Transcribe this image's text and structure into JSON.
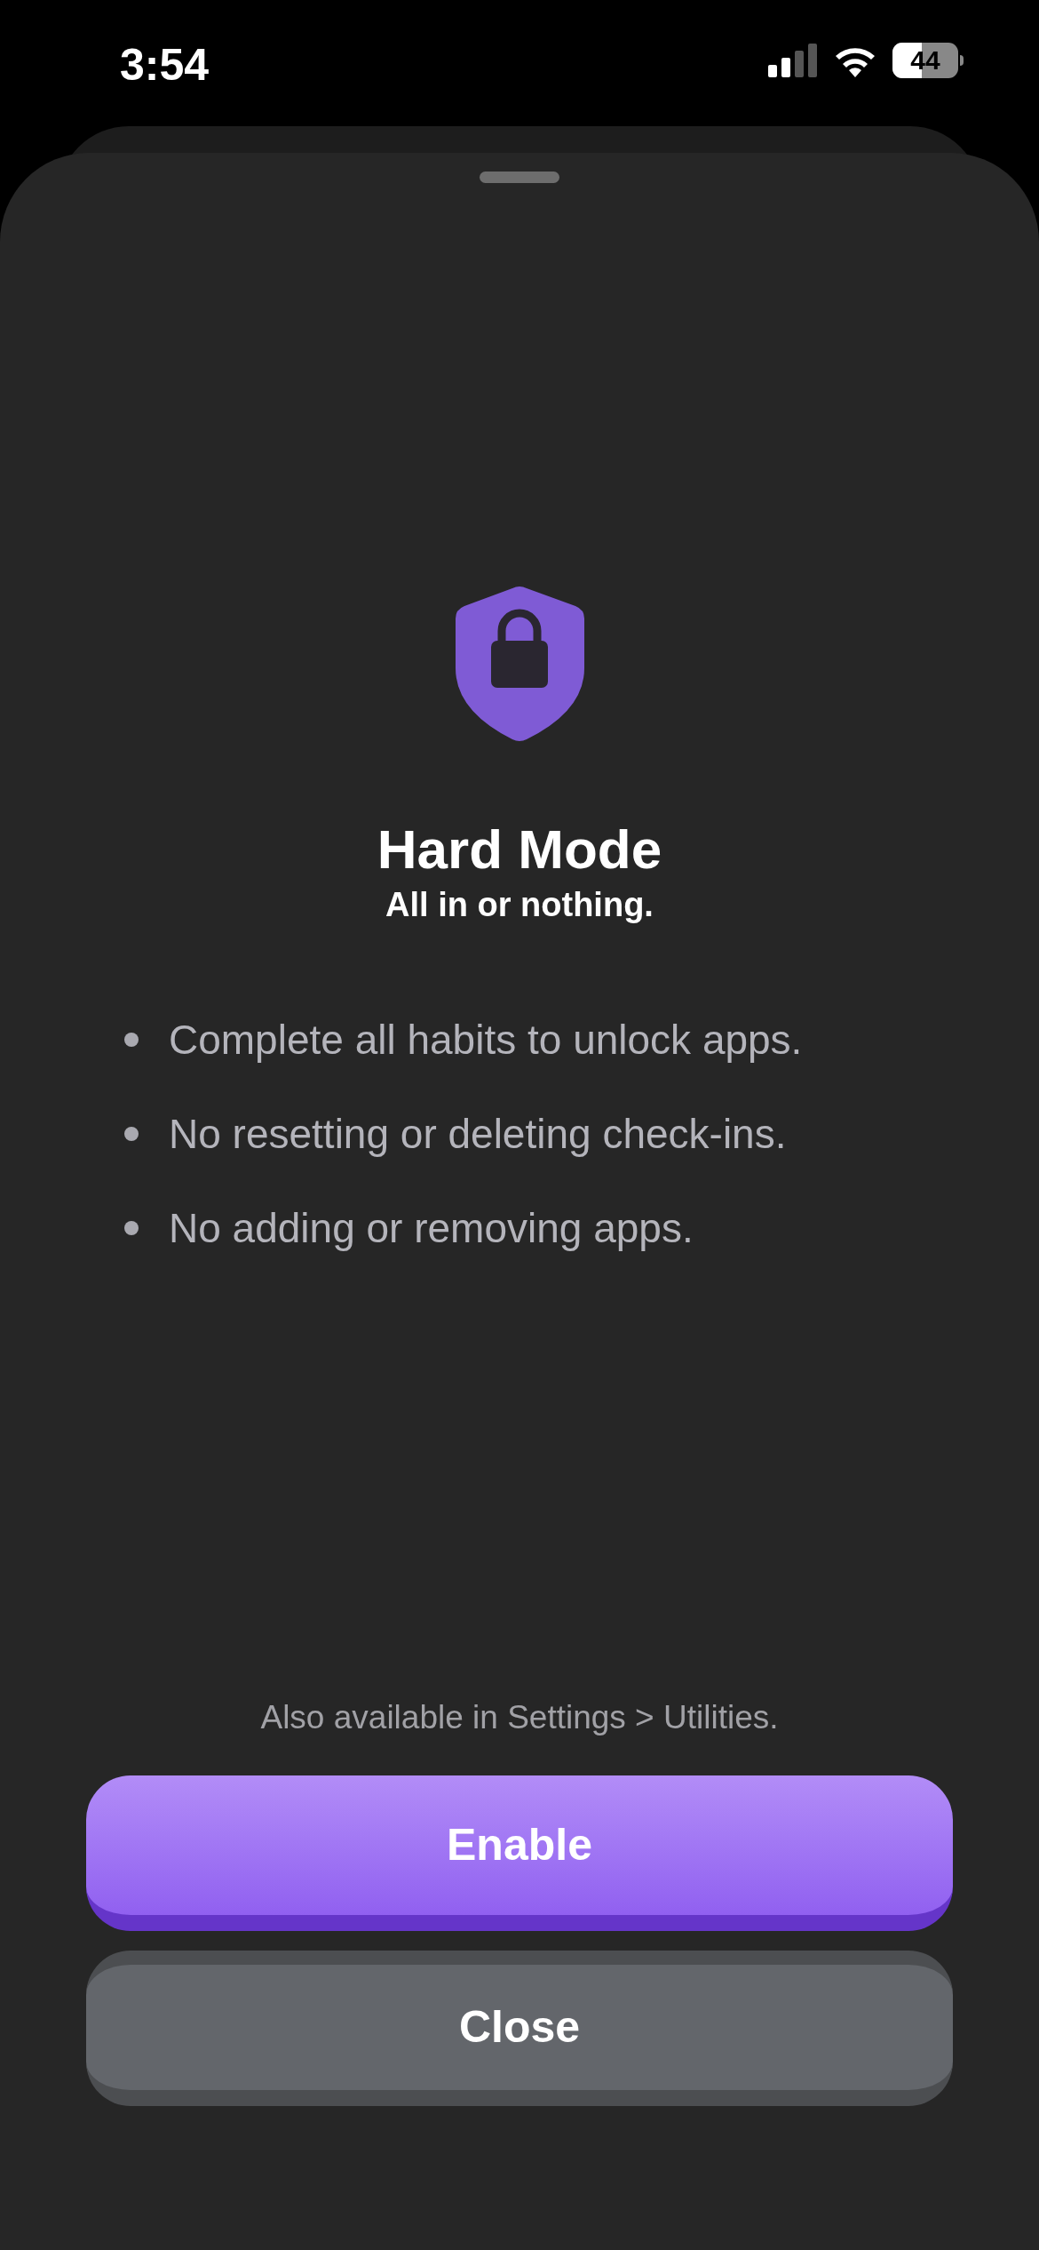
{
  "status_bar": {
    "time": "3:54",
    "battery": "44"
  },
  "sheet": {
    "title": "Hard Mode",
    "subtitle": "All in or nothing.",
    "rules": [
      "Complete all habits to unlock apps.",
      "No resetting or deleting check-ins.",
      "No adding or removing apps."
    ],
    "note": "Also available in Settings > Utilities.",
    "buttons": [
      {
        "label": "Enable",
        "kind": "primary"
      },
      {
        "label": "Close",
        "kind": "secondary"
      }
    ]
  }
}
